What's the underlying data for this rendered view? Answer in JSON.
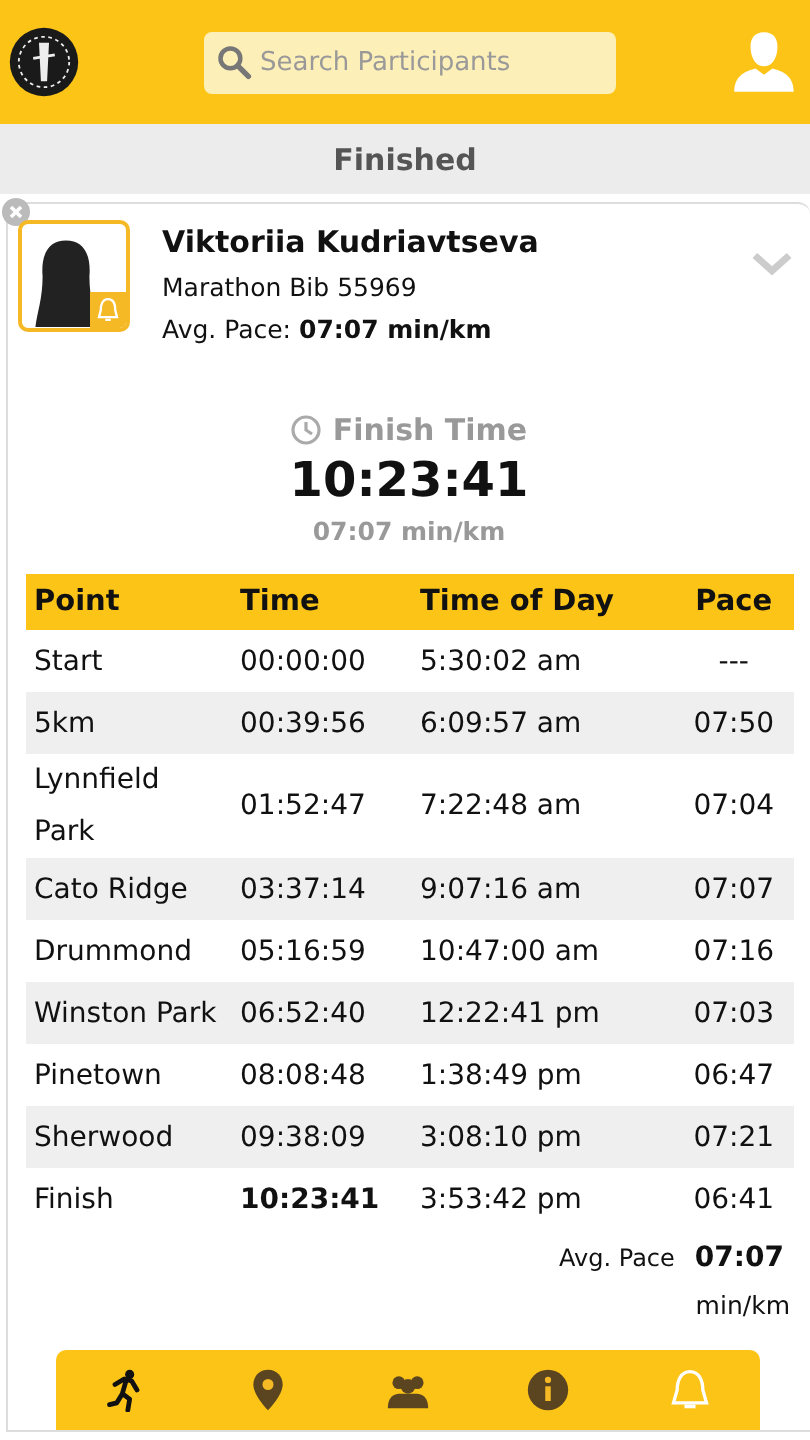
{
  "search": {
    "placeholder": "Search Participants"
  },
  "section_title": "Finished",
  "participant": {
    "name": "Viktoriia Kudriavtseva",
    "bib": "Marathon Bib 55969",
    "pace_label": "Avg. Pace:",
    "pace_value": "07:07 min/km"
  },
  "finish": {
    "label": "Finish Time",
    "time": "10:23:41",
    "pace": "07:07 min/km"
  },
  "table": {
    "columns": [
      "Point",
      "Time",
      "Time of Day",
      "Pace"
    ],
    "rows": [
      {
        "cells": [
          "Start",
          "00:00:00",
          "5:30:02 am",
          "---"
        ],
        "time_bold": false
      },
      {
        "cells": [
          "5km",
          "00:39:56",
          "6:09:57 am",
          "07:50"
        ],
        "time_bold": false
      },
      {
        "cells": [
          "Lynnfield Park",
          "01:52:47",
          "7:22:48 am",
          "07:04"
        ],
        "time_bold": false
      },
      {
        "cells": [
          "Cato Ridge",
          "03:37:14",
          "9:07:16 am",
          "07:07"
        ],
        "time_bold": false
      },
      {
        "cells": [
          "Drummond",
          "05:16:59",
          "10:47:00 am",
          "07:16"
        ],
        "time_bold": false
      },
      {
        "cells": [
          "Winston Park",
          "06:52:40",
          "12:22:41 pm",
          "07:03"
        ],
        "time_bold": false
      },
      {
        "cells": [
          "Pinetown",
          "08:08:48",
          "1:38:49 pm",
          "06:47"
        ],
        "time_bold": false
      },
      {
        "cells": [
          "Sherwood",
          "09:38:09",
          "3:08:10 pm",
          "07:21"
        ],
        "time_bold": false
      },
      {
        "cells": [
          "Finish",
          "10:23:41",
          "3:53:42 pm",
          "06:41"
        ],
        "time_bold": true
      }
    ]
  },
  "avg_pace": {
    "label": "Avg. Pace",
    "value": "07:07",
    "unit": "min/km"
  }
}
